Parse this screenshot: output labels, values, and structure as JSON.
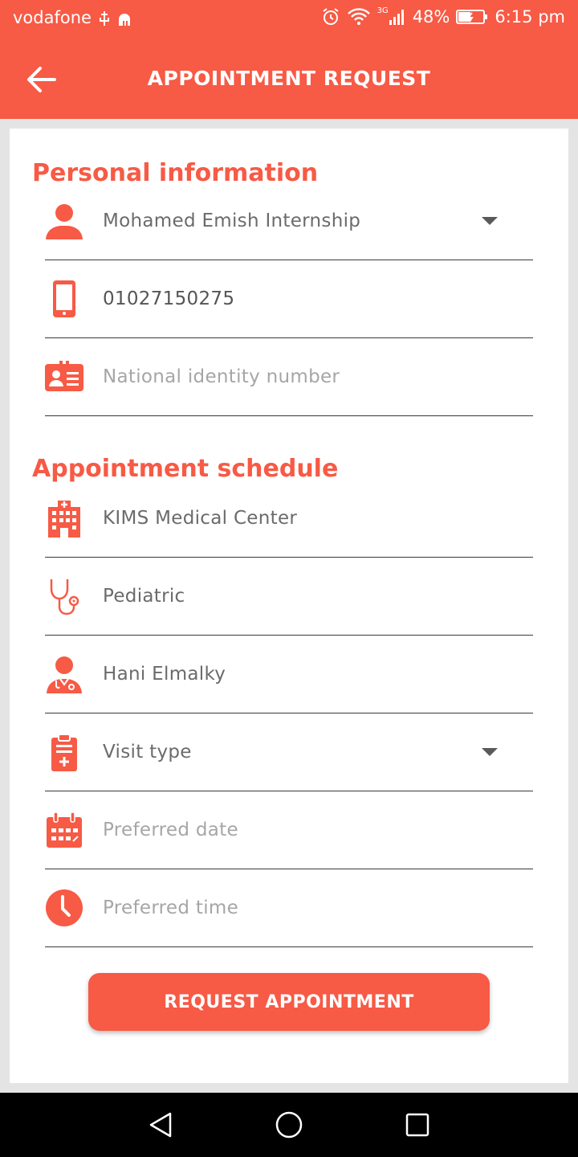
{
  "status_bar": {
    "carrier": "vodafone",
    "network": "3G",
    "battery": "48%",
    "time": "6:15 pm"
  },
  "toolbar": {
    "back_icon": "arrow-left-icon",
    "title": "APPOINTMENT REQUEST"
  },
  "personal": {
    "title": "Personal information",
    "patient": {
      "icon": "person-icon",
      "value": "Mohamed Emish Internship"
    },
    "phone": {
      "icon": "mobile-phone-icon",
      "value": "01027150275"
    },
    "national_id": {
      "icon": "id-card-icon",
      "placeholder": "National identity number",
      "value": ""
    }
  },
  "schedule": {
    "title": "Appointment schedule",
    "center": {
      "icon": "hospital-icon",
      "value": "KIMS Medical Center"
    },
    "specialty": {
      "icon": "stethoscope-icon",
      "value": "Pediatric"
    },
    "doctor": {
      "icon": "doctor-icon",
      "value": "Hani Elmalky"
    },
    "visit_type": {
      "icon": "clipboard-icon",
      "value": "Visit type"
    },
    "date": {
      "icon": "calendar-icon",
      "placeholder": "Preferred date",
      "value": ""
    },
    "time": {
      "icon": "clock-icon",
      "placeholder": "Preferred time",
      "value": ""
    }
  },
  "submit_label": "REQUEST APPOINTMENT",
  "colors": {
    "accent": "#f75a45",
    "text": "#6b6b6b",
    "placeholder": "#a6a6a6"
  }
}
